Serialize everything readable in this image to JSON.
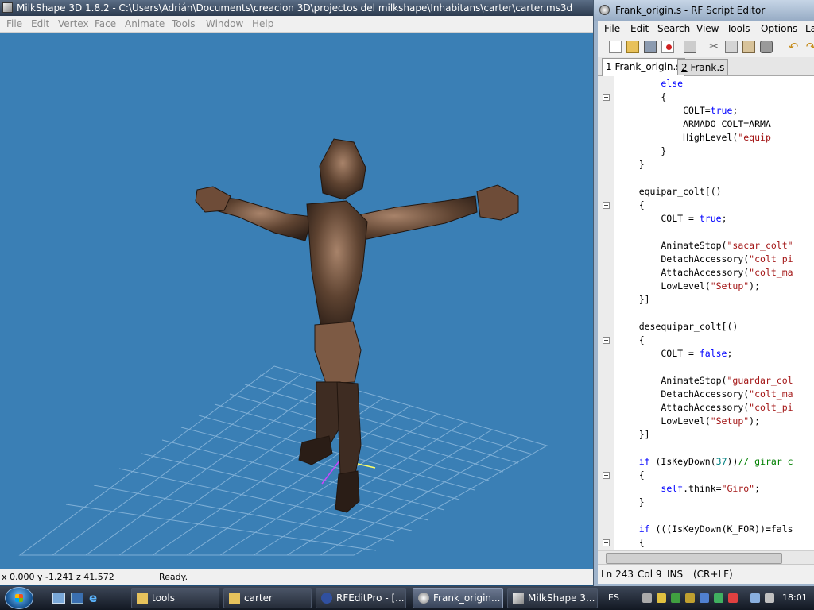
{
  "milkshape": {
    "title": "MilkShape 3D 1.8.2 - C:\\Users\\Adrián\\Documents\\creacion 3D\\projectos del milkshape\\Inhabitans\\carter\\carter.ms3d",
    "menu": [
      "File",
      "Edit",
      "Vertex",
      "Face",
      "Animate",
      "Tools",
      "Window",
      "Help"
    ],
    "status": {
      "coords": "x 0.000 y -1.241 z 41.572",
      "text": "Ready."
    }
  },
  "rf_editor": {
    "title": "Frank_origin.s - RF Script Editor",
    "menu": [
      "File",
      "Edit",
      "Search",
      "View",
      "Tools",
      "Options",
      "La"
    ],
    "toolbar_icons": [
      "new-file-icon",
      "open-folder-icon",
      "save-icon",
      "close-file-icon",
      "print-icon",
      "cut-icon",
      "copy-icon",
      "paste-icon",
      "stamp-icon",
      "undo-icon",
      "redo-icon"
    ],
    "tabs": [
      {
        "number": "1",
        "label": "Frank_origin.s"
      },
      {
        "number": "2",
        "label": "Frank.s"
      }
    ],
    "code_lines": [
      "        else",
      "        {",
      "            COLT=true;",
      "            ARMADO_COLT=ARMA",
      "            HighLevel(\"equip",
      "        }",
      "    }",
      "",
      "    equipar_colt[()",
      "    {",
      "        COLT = true;",
      "",
      "        AnimateStop(\"sacar_colt\"",
      "        DetachAccessory(\"colt_pi",
      "        AttachAccessory(\"colt_ma",
      "        LowLevel(\"Setup\");",
      "    }]",
      "",
      "    desequipar_colt[()",
      "    {",
      "        COLT = false;",
      "",
      "        AnimateStop(\"guardar_col",
      "        DetachAccessory(\"colt_ma",
      "        AttachAccessory(\"colt_pi",
      "        LowLevel(\"Setup\");",
      "    }]",
      "",
      "    if (IsKeyDown(37))// girar c",
      "    {",
      "        self.think=\"Giro\";",
      "    }",
      "",
      "    if (((IsKeyDown(K_FOR))=fals",
      "    {"
    ],
    "status": {
      "line": "Ln 243",
      "col": "Col 9",
      "mode": "INS",
      "eol": "(CR+LF)"
    }
  },
  "taskbar": {
    "tasks": [
      {
        "label": "tools",
        "icon": "folder-icon"
      },
      {
        "label": "carter",
        "icon": "folder-icon"
      },
      {
        "label": "RFEditPro - [...",
        "icon": "rfeditpro-icon"
      },
      {
        "label": "Frank_origin...",
        "icon": "script-editor-icon"
      },
      {
        "label": "MilkShape 3...",
        "icon": "milkshape-icon"
      }
    ],
    "language": "ES",
    "clock": "18:01"
  }
}
